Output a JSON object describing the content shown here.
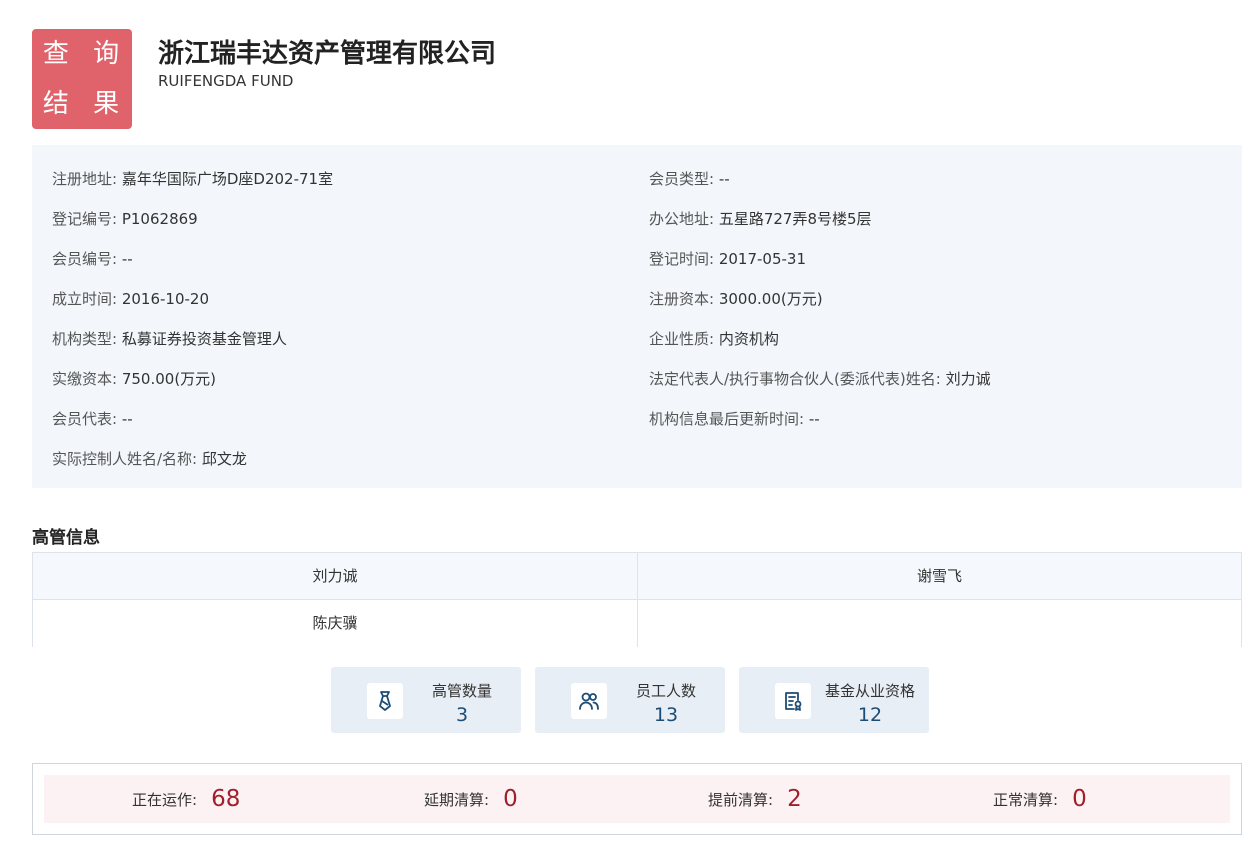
{
  "header": {
    "badge_line1": "查 询",
    "badge_line2": "结 果",
    "company_name": "浙江瑞丰达资产管理有限公司",
    "company_en": "RUIFENGDA FUND"
  },
  "info": {
    "left": [
      {
        "label": "注册地址:",
        "value": "嘉年华国际广场D座D202-71室"
      },
      {
        "label": "登记编号:",
        "value": "P1062869"
      },
      {
        "label": "会员编号:",
        "value": "--"
      },
      {
        "label": "成立时间:",
        "value": "2016-10-20"
      },
      {
        "label": "机构类型:",
        "value": "私募证券投资基金管理人"
      },
      {
        "label": "实缴资本:",
        "value": "750.00(万元)"
      },
      {
        "label": "会员代表:",
        "value": "--"
      },
      {
        "label": "实际控制人姓名/名称:",
        "value": "邱文龙"
      }
    ],
    "right": [
      {
        "label": "会员类型:",
        "value": "--"
      },
      {
        "label": "办公地址:",
        "value": "五星路727弄8号楼5层"
      },
      {
        "label": "登记时间:",
        "value": "2017-05-31"
      },
      {
        "label": "注册资本:",
        "value": "3000.00(万元)"
      },
      {
        "label": "企业性质:",
        "value": "内资机构"
      },
      {
        "label": "法定代表人/执行事物合伙人(委派代表)姓名:",
        "value": "刘力诚"
      },
      {
        "label": "机构信息最后更新时间:",
        "value": "--"
      }
    ]
  },
  "executives": {
    "title": "高管信息",
    "names": [
      "刘力诚",
      "谢雪飞",
      "陈庆骥",
      ""
    ]
  },
  "stats": [
    {
      "label": "高管数量",
      "value": "3",
      "icon": "tie-icon"
    },
    {
      "label": "员工人数",
      "value": "13",
      "icon": "people-icon"
    },
    {
      "label": "基金从业资格",
      "value": "12",
      "icon": "certificate-icon"
    }
  ],
  "funds": [
    {
      "label": "正在运作:",
      "value": "68"
    },
    {
      "label": "延期清算:",
      "value": "0"
    },
    {
      "label": "提前清算:",
      "value": "2"
    },
    {
      "label": "正常清算:",
      "value": "0"
    }
  ],
  "colors": {
    "badge": "#e0626a",
    "panel": "#f3f7fb",
    "stat_value": "#1d4c74",
    "fund_value": "#a01f2a"
  }
}
